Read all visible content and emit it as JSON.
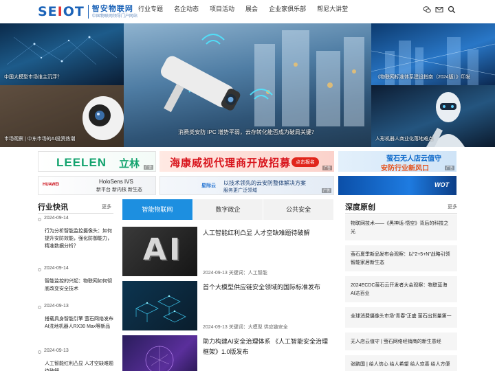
{
  "header": {
    "logo_mark_blue": "SE",
    "logo_mark_red": "I",
    "logo_mark_rest": "OT",
    "logo_name": "智安物联网",
    "logo_sub": "中国物联网领导门户网站",
    "nav": [
      "行业专题",
      "名企动态",
      "项目活动",
      "展会",
      "企业家俱乐部",
      "帮尼大讲堂"
    ],
    "icons": [
      "wechat-icon",
      "mail-icon",
      "search-icon"
    ]
  },
  "hero": {
    "top_left_caption": "中国大模型市场谁主沉浮？",
    "bottom_left_caption": "市场观察 | 中东市场的AI投资热潮",
    "center_caption": "消费类安防 IPC 增势平弱，云存转化能否成为破局关键？",
    "top_right_caption": "《物联网标准体系建设指南（2024版）》印发",
    "bottom_right_caption": "人形机器人商业化落地难点"
  },
  "ads": {
    "leelen_en": "LEELEN",
    "leelen_cn": "立林",
    "hikvision": "海康威视代理商开放招募",
    "hikvision_btn": "点击报名",
    "ezviz_1": "萤石无人店云值守",
    "ezviz_2": "安防行业新风口",
    "huawei": "HUAWEI",
    "holosens": "HoloSens IVS",
    "holosens_sub": "新平台 新内核 新生态",
    "yunbei_brand": "星际云",
    "yunbei_1": "以技术领先的云安防整体解决方案",
    "yunbei_2": "服务更广泛领域",
    "wot": "WOT",
    "ad_tag": "广告"
  },
  "left_column": {
    "title": "行业快讯",
    "more": "更多",
    "items": [
      {
        "date": "2024-09-14",
        "title": "行为分析智能监控摄像头：如何提升安防效能，强化防御能力，精准数据分析？"
      },
      {
        "date": "2024-09-14",
        "title": "智能监控的兴起：物联网如何彻底改变安全技术"
      },
      {
        "date": "2024-09-13",
        "title": "搭载具身智能引擎 萤石网络发布AI洗地机器人RX30 Max等新品"
      },
      {
        "date": "2024-09-13",
        "title": "人工智能红利凸显 人才空缺难题待破解"
      }
    ]
  },
  "tabs": [
    "智能物联网",
    "数字政企",
    "公共安全"
  ],
  "articles": [
    {
      "title": "人工智能红利凸显 人才空缺难题待破解",
      "meta": "2024-09-13 关键词：人工智能",
      "thumb_text": "AI"
    },
    {
      "title": "首个大模型供应链安全领域的国际标准发布",
      "meta": "2024-09-13 关键词：大模型 供应链安全"
    },
    {
      "title": "助力构建AI安全治理体系 《人工智能安全治理框架》1.0版发布",
      "meta": ""
    }
  ],
  "right_column": {
    "title": "深度原创",
    "more": "更多",
    "items": [
      "物联网技术——《黑神话·悟空》背后的科技之光",
      "萤石夏季新品发布会观察：以“2+5+N”战略引领智能家居新生态",
      "2024ECDC萤石云开发者大会观察：物联蓝海 AI达百业",
      "全球消费摄像头市场“青春”正盛 萤石出货量第一",
      "无人店云值守 | 萤石网络经销商的新生意经",
      "张鹏国 | 给人信心 给人希望 给人欢喜 给人方便"
    ]
  }
}
